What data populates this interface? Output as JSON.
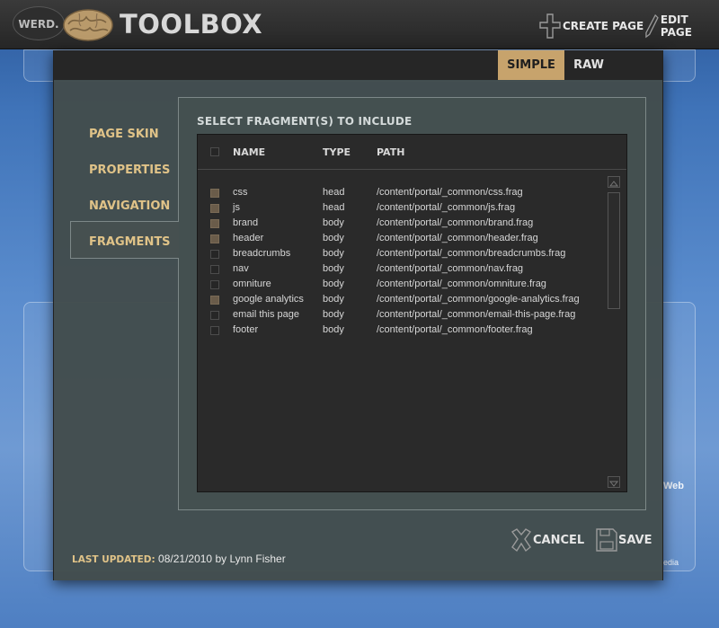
{
  "header": {
    "logo_badge": "WERD.",
    "logo_icon": "brain-icon",
    "title": "TOOLBOX",
    "actions": [
      {
        "label": "CREATE PAGE",
        "icon": "plus-icon"
      },
      {
        "label": "EDIT PAGE",
        "icon": "pencil-icon"
      }
    ]
  },
  "modal": {
    "tabs": [
      {
        "label": "SIMPLE",
        "active": true
      },
      {
        "label": "RAW",
        "active": false
      }
    ],
    "nav": [
      {
        "label": "PAGE SKIN",
        "active": false
      },
      {
        "label": "PROPERTIES",
        "active": false
      },
      {
        "label": "NAVIGATION",
        "active": false
      },
      {
        "label": "FRAGMENTS",
        "active": true
      }
    ],
    "panel_title": "SELECT FRAGMENT(S) TO INCLUDE",
    "table": {
      "columns": [
        "NAME",
        "TYPE",
        "PATH"
      ],
      "rows": [
        {
          "name": "css",
          "type": "head",
          "path": "/content/portal/_common/css.frag",
          "checked": true
        },
        {
          "name": "js",
          "type": "head",
          "path": "/content/portal/_common/js.frag",
          "checked": true
        },
        {
          "name": "brand",
          "type": "body",
          "path": "/content/portal/_common/brand.frag",
          "checked": true
        },
        {
          "name": "header",
          "type": "body",
          "path": "/content/portal/_common/header.frag",
          "checked": true
        },
        {
          "name": "breadcrumbs",
          "type": "body",
          "path": "/content/portal/_common/breadcrumbs.frag",
          "checked": false
        },
        {
          "name": "nav",
          "type": "body",
          "path": "/content/portal/_common/nav.frag",
          "checked": false
        },
        {
          "name": "omniture",
          "type": "body",
          "path": "/content/portal/_common/omniture.frag",
          "checked": false
        },
        {
          "name": "google analytics",
          "type": "body",
          "path": "/content/portal/_common/google-analytics.frag",
          "checked": true
        },
        {
          "name": "email this page",
          "type": "body",
          "path": "/content/portal/_common/email-this-page.frag",
          "checked": false
        },
        {
          "name": "footer",
          "type": "body",
          "path": "/content/portal/_common/footer.frag",
          "checked": false
        }
      ]
    },
    "buttons": {
      "cancel": "CANCEL",
      "save": "SAVE"
    },
    "last_updated": {
      "label": "LAST UPDATED:",
      "value": "08/21/2010 by Lynn Fisher"
    }
  },
  "background": {
    "visible_words": [
      "Web",
      "edia"
    ]
  },
  "colors": {
    "accent": "#c7a36c",
    "nav_text": "#e0c388",
    "modal_bg": "#424c4c",
    "table_bg": "#2a2a2a"
  }
}
